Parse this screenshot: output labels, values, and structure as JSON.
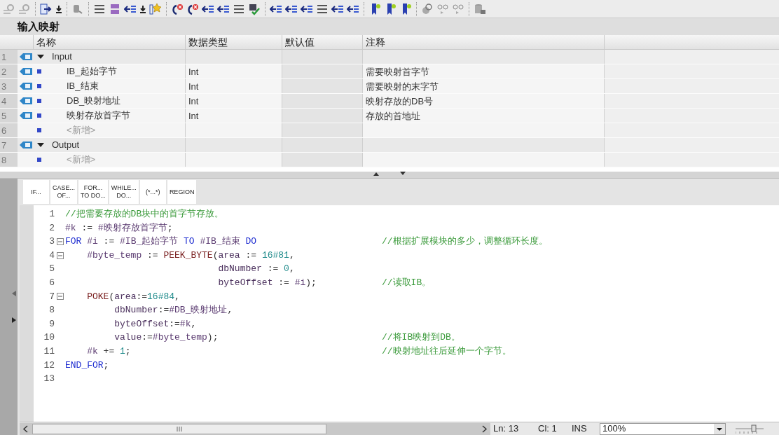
{
  "block_title": "输入映射",
  "table": {
    "columns": [
      "名称",
      "数据类型",
      "默认值",
      "注释"
    ],
    "rows": [
      {
        "number": "1",
        "kind": "group",
        "expanded": true,
        "name": "Input"
      },
      {
        "number": "2",
        "kind": "var",
        "name": "IB_起始字节",
        "type": "Int",
        "comment": "需要映射首字节"
      },
      {
        "number": "3",
        "kind": "var",
        "name": "IB_结束",
        "type": "Int",
        "comment": "需要映射的末字节"
      },
      {
        "number": "4",
        "kind": "var",
        "name": "DB_映射地址",
        "type": "Int",
        "comment": "映射存放的DB号"
      },
      {
        "number": "5",
        "kind": "var",
        "name": "映射存放首字节",
        "type": "Int",
        "comment": "存放的首地址"
      },
      {
        "number": "6",
        "kind": "add",
        "name": "<新增>"
      },
      {
        "number": "7",
        "kind": "group",
        "expanded": true,
        "name": "Output"
      },
      {
        "number": "8",
        "kind": "add",
        "name": "<新增>"
      }
    ]
  },
  "snippets": [
    {
      "lines": [
        "IF..."
      ]
    },
    {
      "lines": [
        "CASE...",
        "OF..."
      ]
    },
    {
      "lines": [
        "FOR...",
        "TO DO..."
      ]
    },
    {
      "lines": [
        "WHILE...",
        "DO..."
      ]
    },
    {
      "lines": [
        "(*...*)"
      ]
    },
    {
      "lines": [
        "REGION"
      ]
    }
  ],
  "code": {
    "lines": [
      {
        "number": "1",
        "fold": false,
        "tokens": [
          {
            "kind": "comment",
            "text": "//把需要存放的DB块中的首字节存放。"
          }
        ]
      },
      {
        "number": "2",
        "fold": false,
        "tokens": [
          {
            "kind": "var",
            "text": "#k"
          },
          {
            "kind": "plain",
            "text": " := "
          },
          {
            "kind": "var",
            "text": "#映射存放首字节"
          },
          {
            "kind": "plain",
            "text": ";"
          }
        ]
      },
      {
        "number": "3",
        "fold": true,
        "tokens": [
          {
            "kind": "kw",
            "text": "FOR"
          },
          {
            "kind": "var",
            "text": " #i"
          },
          {
            "kind": "plain",
            "text": " := "
          },
          {
            "kind": "var",
            "text": "#IB_起始字节"
          },
          {
            "kind": "kw",
            "text": " TO"
          },
          {
            "kind": "var",
            "text": " #IB_结束"
          },
          {
            "kind": "kw",
            "text": " DO"
          }
        ],
        "comment": "//根据扩展模块的多少，调整循环长度。"
      },
      {
        "number": "4",
        "fold": true,
        "tokens": [
          {
            "kind": "var",
            "text": "    #byte_temp"
          },
          {
            "kind": "plain",
            "text": " := "
          },
          {
            "kind": "fn",
            "text": "PEEK_BYTE"
          },
          {
            "kind": "plain",
            "text": "("
          },
          {
            "kind": "param",
            "text": "area"
          },
          {
            "kind": "plain",
            "text": " := "
          },
          {
            "kind": "num",
            "text": "16#81"
          },
          {
            "kind": "plain",
            "text": ","
          }
        ]
      },
      {
        "number": "5",
        "fold": false,
        "tokens": [
          {
            "kind": "param",
            "text": "                            dbNumber"
          },
          {
            "kind": "plain",
            "text": " := "
          },
          {
            "kind": "num",
            "text": "0"
          },
          {
            "kind": "plain",
            "text": ","
          }
        ]
      },
      {
        "number": "6",
        "fold": false,
        "tokens": [
          {
            "kind": "param",
            "text": "                            byteOffset"
          },
          {
            "kind": "plain",
            "text": " := "
          },
          {
            "kind": "var",
            "text": "#i"
          },
          {
            "kind": "plain",
            "text": ");"
          }
        ],
        "comment": "//读取IB。"
      },
      {
        "number": "7",
        "fold": true,
        "tokens": [
          {
            "kind": "fn",
            "text": "    POKE"
          },
          {
            "kind": "plain",
            "text": "("
          },
          {
            "kind": "param",
            "text": "area"
          },
          {
            "kind": "plain",
            "text": ":="
          },
          {
            "kind": "num",
            "text": "16#84"
          },
          {
            "kind": "plain",
            "text": ","
          }
        ]
      },
      {
        "number": "8",
        "fold": false,
        "tokens": [
          {
            "kind": "param",
            "text": "         dbNumber"
          },
          {
            "kind": "plain",
            "text": ":="
          },
          {
            "kind": "var",
            "text": "#DB_映射地址"
          },
          {
            "kind": "plain",
            "text": ","
          }
        ]
      },
      {
        "number": "9",
        "fold": false,
        "tokens": [
          {
            "kind": "param",
            "text": "         byteOffset"
          },
          {
            "kind": "plain",
            "text": ":="
          },
          {
            "kind": "var",
            "text": "#k"
          },
          {
            "kind": "plain",
            "text": ","
          }
        ]
      },
      {
        "number": "10",
        "fold": false,
        "tokens": [
          {
            "kind": "param",
            "text": "         value"
          },
          {
            "kind": "plain",
            "text": ":="
          },
          {
            "kind": "var",
            "text": "#byte_temp"
          },
          {
            "kind": "plain",
            "text": ");"
          }
        ],
        "comment": "//将IB映射到DB。"
      },
      {
        "number": "11",
        "fold": false,
        "tokens": [
          {
            "kind": "var",
            "text": "    #k"
          },
          {
            "kind": "plain",
            "text": " += "
          },
          {
            "kind": "num",
            "text": "1"
          },
          {
            "kind": "plain",
            "text": ";"
          }
        ],
        "comment": "//映射地址往后延伸一个字节。"
      },
      {
        "number": "12",
        "fold": false,
        "tokens": [
          {
            "kind": "kw",
            "text": "END_FOR"
          },
          {
            "kind": "plain",
            "text": ";"
          }
        ]
      },
      {
        "number": "13",
        "fold": false
      }
    ]
  },
  "status_bar": {
    "line": "Ln: 13",
    "column": "Cl: 1",
    "mode": "INS",
    "zoom": "100%"
  }
}
